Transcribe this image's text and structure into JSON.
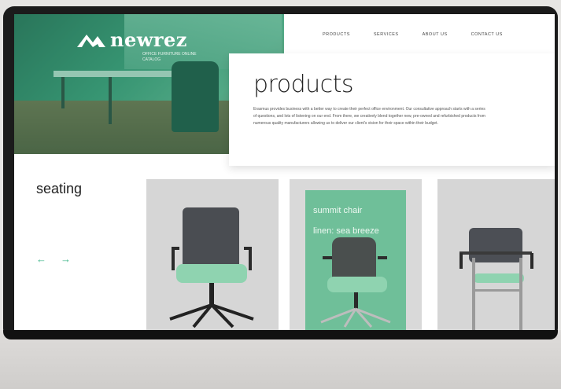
{
  "brand": {
    "name": "newrez",
    "tagline": "OFFICE FURNITURE ONLINE CATALOG"
  },
  "nav": {
    "items": [
      "PRODUCTS",
      "SERVICES",
      "ABOUT US",
      "CONTACT US"
    ]
  },
  "products": {
    "title": "products",
    "description": "Erasmus provides business with a better way to create their perfect office environment. Our consultative approach starts with a series of questions, and lots of listening on our end. From there, we creatively blend together new, pre-owned and refurbished products from numerous quality manufacturers allowing us to deliver our client's vision for their space within their budget."
  },
  "seating": {
    "title": "seating",
    "prev_icon": "←",
    "next_icon": "→"
  },
  "cards": [
    {
      "name": "",
      "sub": ""
    },
    {
      "name": "summit chair",
      "sub": "linen: sea breeze"
    },
    {
      "name": "",
      "sub": ""
    }
  ],
  "colors": {
    "accent": "#3fb68a",
    "hero_green": "#2aa878",
    "card_bg": "#d6d6d6",
    "chair_seat": "#8fd3b0"
  }
}
